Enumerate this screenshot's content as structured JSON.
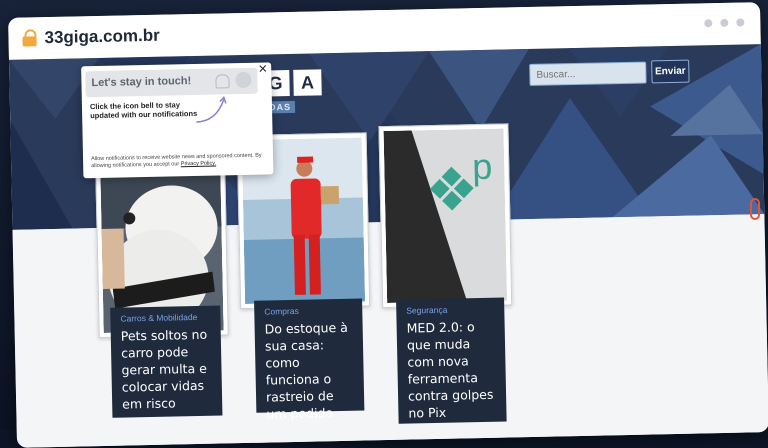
{
  "browser": {
    "url": "33giga.com.br"
  },
  "site": {
    "logo_letters": [
      "G",
      "A"
    ],
    "logo_sub": "DAS",
    "search_placeholder": "Buscar...",
    "search_button": "Enviar"
  },
  "popup": {
    "title": "Let's stay in touch!",
    "close": "×",
    "description": "Click the icon bell to stay updated with our notifications",
    "fine_print": "Allow notifications to receive website news and sponsored content. By allowing notifications you accept our",
    "privacy_link": "Privacy Policy."
  },
  "articles": [
    {
      "category": "Carros & Mobilidade",
      "title": "Pets soltos no carro pode gerar multa e colocar vidas em risco"
    },
    {
      "category": "Compras",
      "title": "Do estoque à sua casa: como funciona o rastreio de um pedido"
    },
    {
      "category": "Segurança",
      "title": "MED 2.0: o que muda com nova ferramenta contra golpes no Pix"
    }
  ],
  "colors": {
    "banner": "#2a3a5a",
    "caption_bg": "#1f2a3d",
    "category_text": "#7aa3e8",
    "lock": "#f2a93b"
  }
}
